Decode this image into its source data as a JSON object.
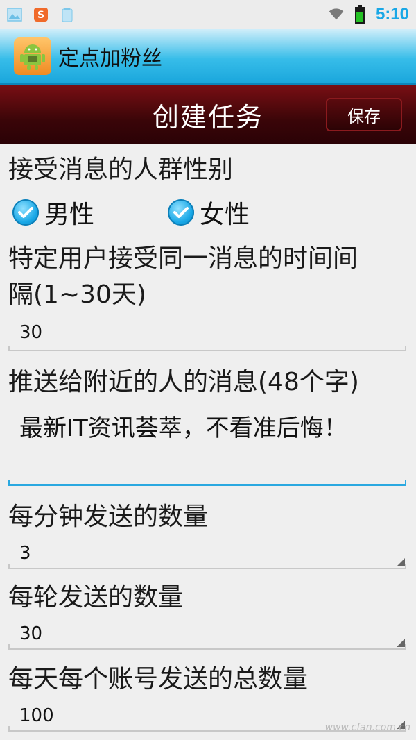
{
  "status_bar": {
    "time": "5:10"
  },
  "app": {
    "title": "定点加粉丝"
  },
  "header": {
    "title": "创建任务",
    "save_label": "保存"
  },
  "form": {
    "gender_label": "接受消息的人群性别",
    "gender_options": [
      {
        "label": "男性",
        "checked": true
      },
      {
        "label": "女性",
        "checked": true
      }
    ],
    "interval_label_line1": "特定用户接受同一消息的时间间",
    "interval_label_line2": "隔(1~30天)",
    "interval_value": "30",
    "message_label": "推送给附近的人的消息(48个字)",
    "message_value": "最新IT资讯荟萃，不看准后悔！",
    "per_minute_label": "每分钟发送的数量",
    "per_minute_value": "3",
    "per_round_label": "每轮发送的数量",
    "per_round_value": "30",
    "per_day_label": "每天每个账号发送的总数量",
    "per_day_value": "100"
  },
  "watermark": "www.cfan.com.cn",
  "colors": {
    "accent": "#18a7e6",
    "header": "#3a0508",
    "appbar": "#37bde9"
  }
}
